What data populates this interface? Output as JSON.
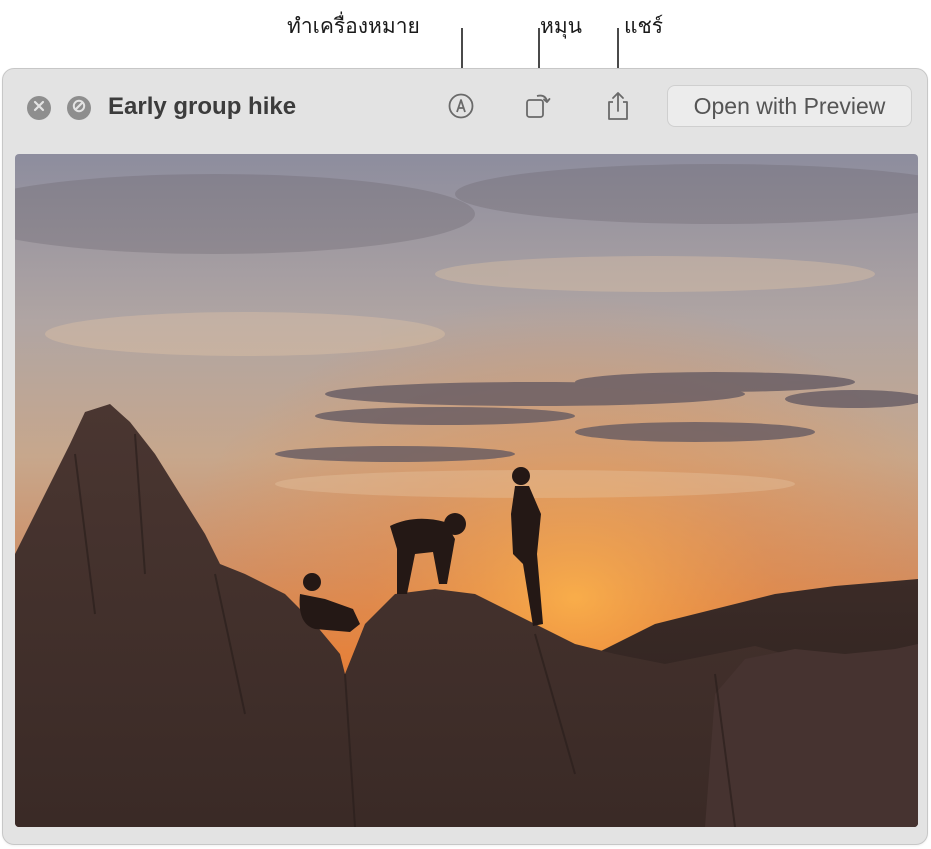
{
  "callouts": {
    "markup": "ทำเครื่องหมาย",
    "rotate": "หมุน",
    "share": "แชร์"
  },
  "window": {
    "title": "Early group hike",
    "open_button_label": "Open with Preview"
  },
  "icons": {
    "close": "close-icon",
    "hide": "hide-icon",
    "markup": "markup-icon",
    "rotate": "rotate-icon",
    "share": "share-icon"
  },
  "colors": {
    "window_bg": "#e3e3e3",
    "title_text": "#3c3c3c",
    "button_gray": "#8e8e8e"
  }
}
